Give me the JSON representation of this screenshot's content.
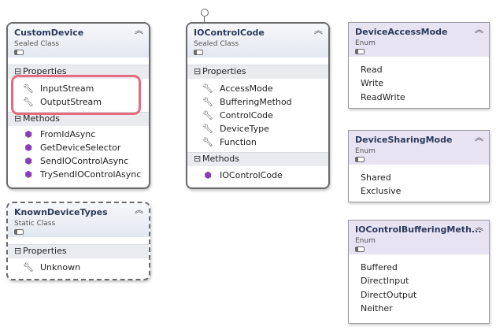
{
  "custom_device": {
    "name": "CustomDevice",
    "kind": "Sealed Class",
    "sections": {
      "properties": "Properties",
      "methods": "Methods"
    },
    "properties": [
      "InputStream",
      "OutputStream"
    ],
    "methods": [
      "FromIdAsync",
      "GetDeviceSelector",
      "SendIOControlAsync",
      "TrySendIOControlAsync"
    ]
  },
  "io_control_code": {
    "name": "IOControlCode",
    "kind": "Sealed Class",
    "sections": {
      "properties": "Properties",
      "methods": "Methods"
    },
    "properties": [
      "AccessMode",
      "BufferingMethod",
      "ControlCode",
      "DeviceType",
      "Function"
    ],
    "methods": [
      "IOControlCode"
    ]
  },
  "known_device_types": {
    "name": "KnownDeviceTypes",
    "kind": "Static Class",
    "sections": {
      "properties": "Properties"
    },
    "properties": [
      "Unknown"
    ]
  },
  "device_access_mode": {
    "name": "DeviceAccessMode",
    "kind": "Enum",
    "values": [
      "Read",
      "Write",
      "ReadWrite"
    ]
  },
  "device_sharing_mode": {
    "name": "DeviceSharingMode",
    "kind": "Enum",
    "values": [
      "Shared",
      "Exclusive"
    ]
  },
  "io_control_buffering_method": {
    "name": "IOControlBufferingMeth...",
    "kind": "Enum",
    "values": [
      "Buffered",
      "DirectInput",
      "DirectOutput",
      "Neither"
    ]
  },
  "colors": {
    "highlight": "#e56b7f",
    "method_icon": "#8a3db6",
    "enum_header": "#e7e3f3"
  },
  "icons": {
    "property": "wrench-icon",
    "method": "cube-icon",
    "collapse": "double-chevron-up-icon",
    "section_toggle": "minus-box-icon"
  }
}
